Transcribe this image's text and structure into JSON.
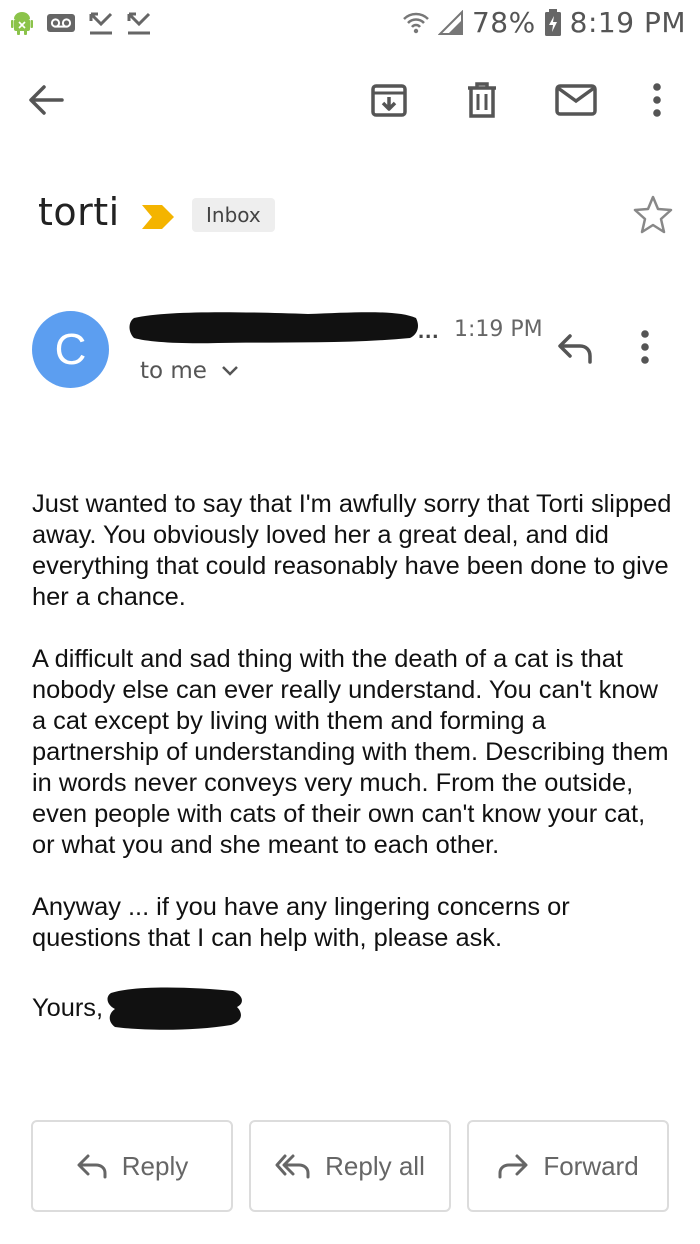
{
  "statusbar": {
    "battery": "78%",
    "time": "8:19 PM"
  },
  "toolbar": {
    "icons": [
      "back-arrow-icon",
      "archive-icon",
      "trash-icon",
      "mail-icon",
      "more-vert-icon"
    ]
  },
  "email": {
    "subject": "torti",
    "label": "Inbox",
    "sender_initial": "C",
    "time": "1:19 PM",
    "recipient": "to me",
    "paragraphs": [
      "Just wanted to say that I'm awfully sorry that Torti slipped away. You obviously loved her a great deal, and did everything that could reasonably have been done to give her a chance.",
      "A difficult and sad thing with the death of a cat is that nobody else can ever really understand. You can't know a cat except by living with them and forming a partnership of understanding with them. Describing them in words never conveys very much. From the outside, even people with cats of their own can't know your cat, or what you and she meant to each other.",
      "Anyway ... if you have any lingering concerns or questions that I can help with, please ask."
    ],
    "signoff": "Yours,"
  },
  "actions": {
    "reply": "Reply",
    "reply_all": "Reply all",
    "forward": "Forward"
  },
  "colors": {
    "avatar": "#5c9ef0",
    "importance": "#f4b400"
  }
}
